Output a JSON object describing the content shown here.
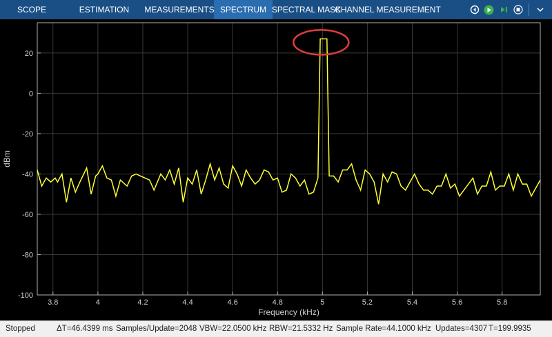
{
  "tabs": [
    {
      "label": "SCOPE",
      "active": false
    },
    {
      "label": "ESTIMATION",
      "active": false
    },
    {
      "label": "MEASUREMENTS",
      "active": false
    },
    {
      "label": "SPECTRUM",
      "active": true
    },
    {
      "label": "SPECTRAL MASK",
      "active": false
    },
    {
      "label": "CHANNEL MEASUREMENTS",
      "active": false
    }
  ],
  "controls": [
    "step-back-icon",
    "run-icon",
    "step-forward-icon",
    "stop-icon",
    "more-icon"
  ],
  "plot": {
    "background": "#000000",
    "trace_color": "#ffff33",
    "highlight_color": "#e03c3c",
    "grid": true
  },
  "chart_data": {
    "type": "line",
    "xlabel": "Frequency (kHz)",
    "ylabel": "dBm",
    "xlim": [
      3.73,
      5.97
    ],
    "ylim": [
      -100,
      35
    ],
    "xticks": [
      3.8,
      4.0,
      4.2,
      4.4,
      4.6,
      4.8,
      5.0,
      5.2,
      5.4,
      5.6,
      5.8
    ],
    "xtick_labels": [
      "3.8",
      "4",
      "4.2",
      "4.4",
      "4.6",
      "4.8",
      "5",
      "5.2",
      "5.4",
      "5.6",
      "5.8"
    ],
    "yticks": [
      20,
      0,
      -20,
      -40,
      -60,
      -80,
      -100
    ],
    "ytick_labels": [
      "20",
      "0",
      "-20",
      "-40",
      "-60",
      "-80",
      "-100"
    ],
    "series": [
      {
        "x": [
          3.73,
          3.75,
          3.77,
          3.79,
          3.81,
          3.82,
          3.84,
          3.86,
          3.88,
          3.9,
          3.92,
          3.95,
          3.97,
          3.99,
          4.0,
          4.02,
          4.04,
          4.06,
          4.08,
          4.1,
          4.13,
          4.15,
          4.17,
          4.19,
          4.21,
          4.23,
          4.25,
          4.28,
          4.3,
          4.32,
          4.34,
          4.36,
          4.38,
          4.4,
          4.42,
          4.44,
          4.46,
          4.48,
          4.5,
          4.52,
          4.54,
          4.56,
          4.58,
          4.6,
          4.62,
          4.64,
          4.66,
          4.68,
          4.7,
          4.72,
          4.74,
          4.76,
          4.78,
          4.8,
          4.82,
          4.84,
          4.86,
          4.88,
          4.9,
          4.92,
          4.94,
          4.96,
          4.98,
          4.99,
          5.0,
          5.01,
          5.02,
          5.03,
          5.05,
          5.07,
          5.09,
          5.11,
          5.13,
          5.15,
          5.17,
          5.19,
          5.21,
          5.23,
          5.25,
          5.27,
          5.29,
          5.31,
          5.33,
          5.35,
          5.37,
          5.39,
          5.41,
          5.43,
          5.45,
          5.47,
          5.49,
          5.51,
          5.53,
          5.55,
          5.57,
          5.59,
          5.61,
          5.63,
          5.65,
          5.67,
          5.69,
          5.71,
          5.73,
          5.75,
          5.77,
          5.79,
          5.81,
          5.83,
          5.85,
          5.87,
          5.89,
          5.91,
          5.93,
          5.95,
          5.97
        ],
        "y": [
          -38,
          -46,
          -42,
          -44,
          -42,
          -44,
          -40,
          -54,
          -42,
          -49,
          -44,
          -37,
          -50,
          -41,
          -40,
          -36,
          -42,
          -43,
          -51,
          -43,
          -46,
          -41,
          -40,
          -41,
          -42,
          -43,
          -48,
          -40,
          -43,
          -38,
          -45,
          -37,
          -54,
          -42,
          -45,
          -38,
          -50,
          -43,
          -35,
          -43,
          -37,
          -45,
          -47,
          -36,
          -40,
          -46,
          -38,
          -42,
          -45,
          -43,
          -38,
          -39,
          -43,
          -42,
          -49,
          -48,
          -40,
          -42,
          -46,
          -43,
          -50,
          -49,
          -42,
          27,
          27,
          27,
          27,
          -41,
          -41,
          -44,
          -38,
          -38,
          -35,
          -43,
          -48,
          -38,
          -40,
          -44,
          -55,
          -40,
          -44,
          -39,
          -40,
          -46,
          -48,
          -44,
          -40,
          -45,
          -48,
          -48,
          -50,
          -46,
          -46,
          -40,
          -47,
          -45,
          -51,
          -48,
          -45,
          -42,
          -50,
          -46,
          -46,
          -39,
          -48,
          -46,
          -46,
          -40,
          -48,
          -40,
          -45,
          -45,
          -51,
          -47,
          -43
        ]
      }
    ]
  },
  "status": {
    "state": "Stopped",
    "dt": "ΔT=46.4399 ms",
    "samples": "Samples/Update=2048",
    "vbw": "VBW=22.0500 kHz",
    "rbw": "RBW=21.5332 Hz",
    "sample_rate": "Sample Rate=44.1000 kHz",
    "updates": "Updates=4307",
    "time": "T=199.9935"
  }
}
